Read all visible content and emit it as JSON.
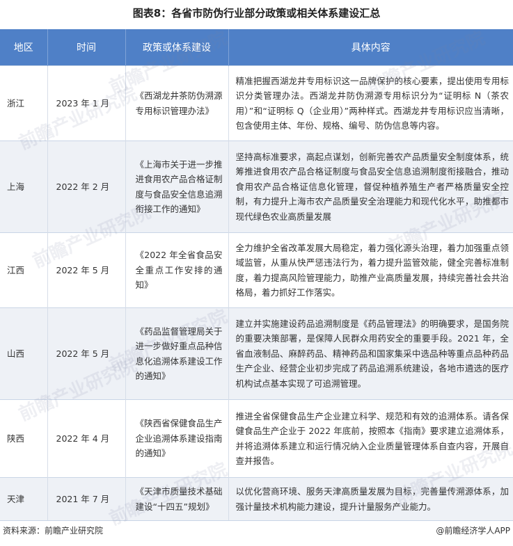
{
  "title": "图表8：各省市防伪行业部分政策或相关体系建设汇总",
  "table": {
    "headers": [
      "地区",
      "时间",
      "政策或体系建设",
      "具体内容"
    ],
    "rows": [
      {
        "region": "浙江",
        "time": "2023 年 1 月",
        "policy": "《西湖龙井茶防伪溯源专用标识管理办法》",
        "detail": "精准把握西湖龙井专用标识这一品牌保护的核心要素，提出使用专用标识分类管理办法。西湖龙井防伪溯源专用标识分为“证明标 N（茶农用）”和“证明标 Q（企业用）”两种样式。西湖龙井专用标识应当清晰，包含使用主体、年份、规格、编号、防伪信息等内容。"
      },
      {
        "region": "上海",
        "time": "2022 年 2 月",
        "policy": "《上海市关于进一步推进食用农产品合格证制度与食品安全信息追溯衔接工作的通知》",
        "detail": "坚持高标准要求，高起点谋划，创新完善农产品质量安全制度体系，统筹推进食用农产品合格证制度与食品安全信息追溯制度衔接融合，推动食用农产品合格证信息化管理，督促种植养殖生产者严格质量安全控制，有力提升上海市农产品质量安全治理能力和现代化水平，助推都市现代绿色农业高质量发展"
      },
      {
        "region": "江西",
        "time": "2022 年 5 月",
        "policy": "《2022 年全省食品安全重点工作安排的通知》",
        "detail": "全力维护全省改革发展大局稳定，着力强化源头治理，着力加强重点领域监管，从重从快严惩违法行为，着力提升监管效能，健全完善标准制度，着力提高风险管理能力，助推产业高质量发展，持续完善社会共治格局，着力抓好工作落实。"
      },
      {
        "region": "山西",
        "time": "2022 年 5 月",
        "policy": "《药品监督管理局关于进一步做好重点品种信息化追溯体系建设工作的通知》",
        "detail": "建立并实施建设药品追溯制度是《药品管理法》的明确要求，是国务院的重要决策部署，是保障人民群众用药安全的重要手段。2021 年，全省血液制品、麻醉药品、精神药品和国家集采中选品种等重点品种药品生产企业、经营企业初步完成了药品追溯系统建设，各地市遴选的医疗机构试点基本实现了可追溯管理。"
      },
      {
        "region": "陕西",
        "time": "2022 年 4 月",
        "policy": "《陕西省保健食品生产企业追溯体系建设指南的通知》",
        "detail": "推进全省保健食品生产企业建立科学、规范和有效的追溯体系。请各保健食品生产企业于 2022 年底前，按照本《指南》要求建立追溯体系，并将追溯体系建立和运行情况纳入企业质量管理体系自查内容，开展自查并报告。"
      },
      {
        "region": "天津",
        "time": "2021 年 7 月",
        "policy": "《天津市质量技术基础建设“十四五”规划》",
        "detail": "以优化营商环境、服务天津高质量发展为目标，完善量传溯源体系，加强计量技术机构能力建设，提升计量服务产业能力。"
      }
    ]
  },
  "footer": {
    "source": "资料来源：前瞻产业研究院",
    "brand": "@前瞻经济学人APP"
  },
  "watermark": "前瞻产业研究院",
  "colors": {
    "header_bg": "#4f80c7",
    "stripe": "#eef1f6"
  }
}
